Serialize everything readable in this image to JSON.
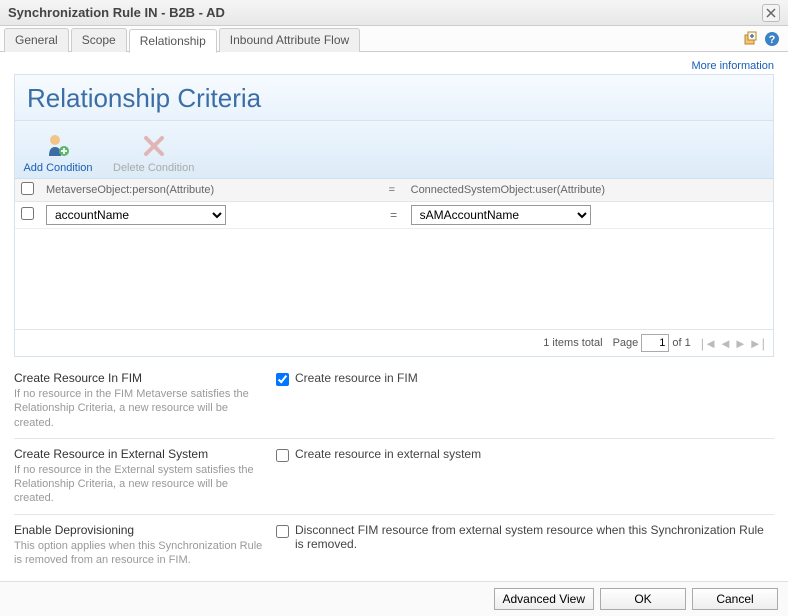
{
  "window": {
    "title": "Synchronization Rule IN - B2B - AD"
  },
  "tabs": [
    {
      "label": "General"
    },
    {
      "label": "Scope"
    },
    {
      "label": "Relationship"
    },
    {
      "label": "Inbound Attribute Flow"
    }
  ],
  "more_info": "More information",
  "panel": {
    "title": "Relationship Criteria"
  },
  "toolbar": {
    "add_condition": "Add Condition",
    "delete_condition": "Delete Condition"
  },
  "criteria": {
    "header_left": "MetaverseObject:person(Attribute)",
    "header_eq": "=",
    "header_right": "ConnectedSystemObject:user(Attribute)",
    "row_eq": "=",
    "left_value": "accountName",
    "right_value": "sAMAccountName"
  },
  "pager": {
    "total_text": "1 items total",
    "page_label": "Page",
    "page_value": "1",
    "of_text": "of 1"
  },
  "options": {
    "create_fim": {
      "title": "Create Resource In FIM",
      "desc": "If no resource in the FIM Metaverse satisfies the Relationship Criteria, a new resource will be created.",
      "checkbox_label": "Create resource in FIM",
      "checked": true
    },
    "create_ext": {
      "title": "Create Resource in External System",
      "desc": "If no resource in the External system satisfies the Relationship Criteria, a new resource will be created.",
      "checkbox_label": "Create resource in external system",
      "checked": false
    },
    "deprov": {
      "title": "Enable Deprovisioning",
      "desc": "This option applies when this Synchronization Rule is removed from an resource in FIM.",
      "checkbox_label": "Disconnect FIM resource from external system resource when this Synchronization Rule is removed.",
      "checked": false
    }
  },
  "footer": {
    "advanced": "Advanced View",
    "ok": "OK",
    "cancel": "Cancel"
  }
}
